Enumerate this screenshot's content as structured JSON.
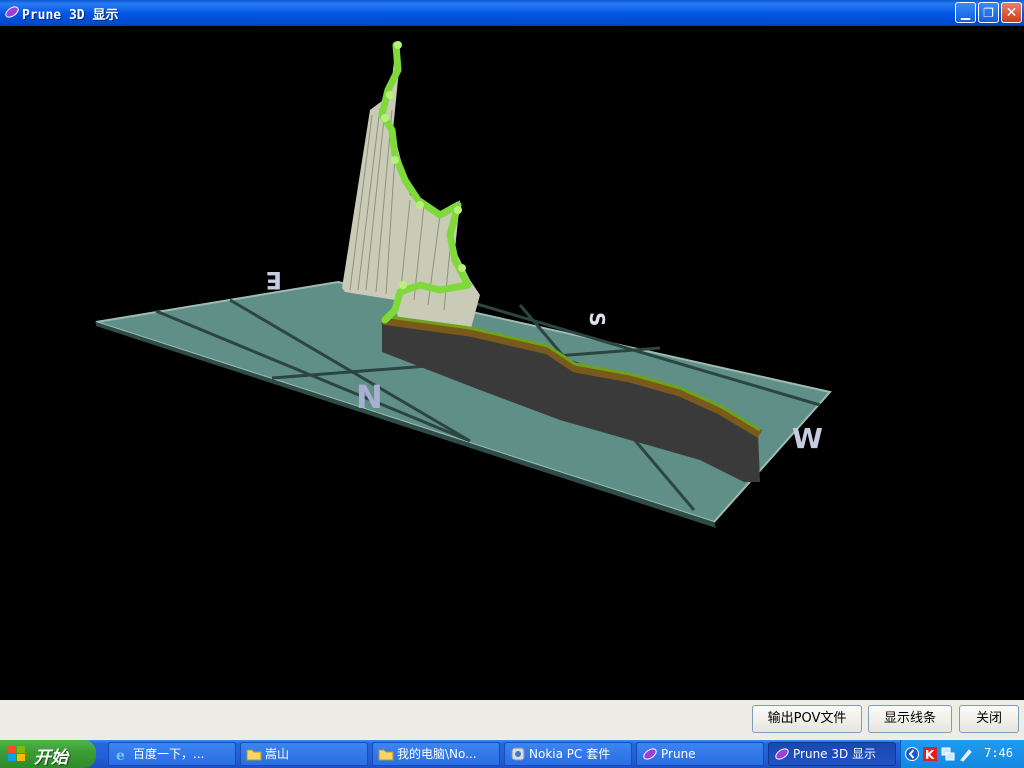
{
  "window": {
    "title": "Prune 3D 显示",
    "minimize_icon": "minimize-icon",
    "restore_icon": "restore-icon",
    "close_icon": "close-icon"
  },
  "viewport": {
    "compass": {
      "north": "N",
      "south": "S",
      "east": "E",
      "west": "W"
    },
    "colors": {
      "ground": "#5f8f86",
      "path": "#7fd93a",
      "curtain": "#c9cbb7",
      "base": "#3a3a3a"
    }
  },
  "buttons": {
    "export_pov": "输出POV文件",
    "show_lines": "显示线条",
    "close": "关闭"
  },
  "taskbar": {
    "start_label": "开始",
    "tasks": [
      {
        "label": "百度一下，...",
        "icon": "ie-icon"
      },
      {
        "label": "嵩山",
        "icon": "folder-icon"
      },
      {
        "label": "我的电脑\\No...",
        "icon": "folder-icon"
      },
      {
        "label": "Nokia PC 套件",
        "icon": "nokia-pc-suite-icon"
      },
      {
        "label": "Prune",
        "icon": "prune-icon"
      },
      {
        "label": "Prune 3D 显示",
        "icon": "prune-icon"
      }
    ],
    "clock": "7:46"
  }
}
